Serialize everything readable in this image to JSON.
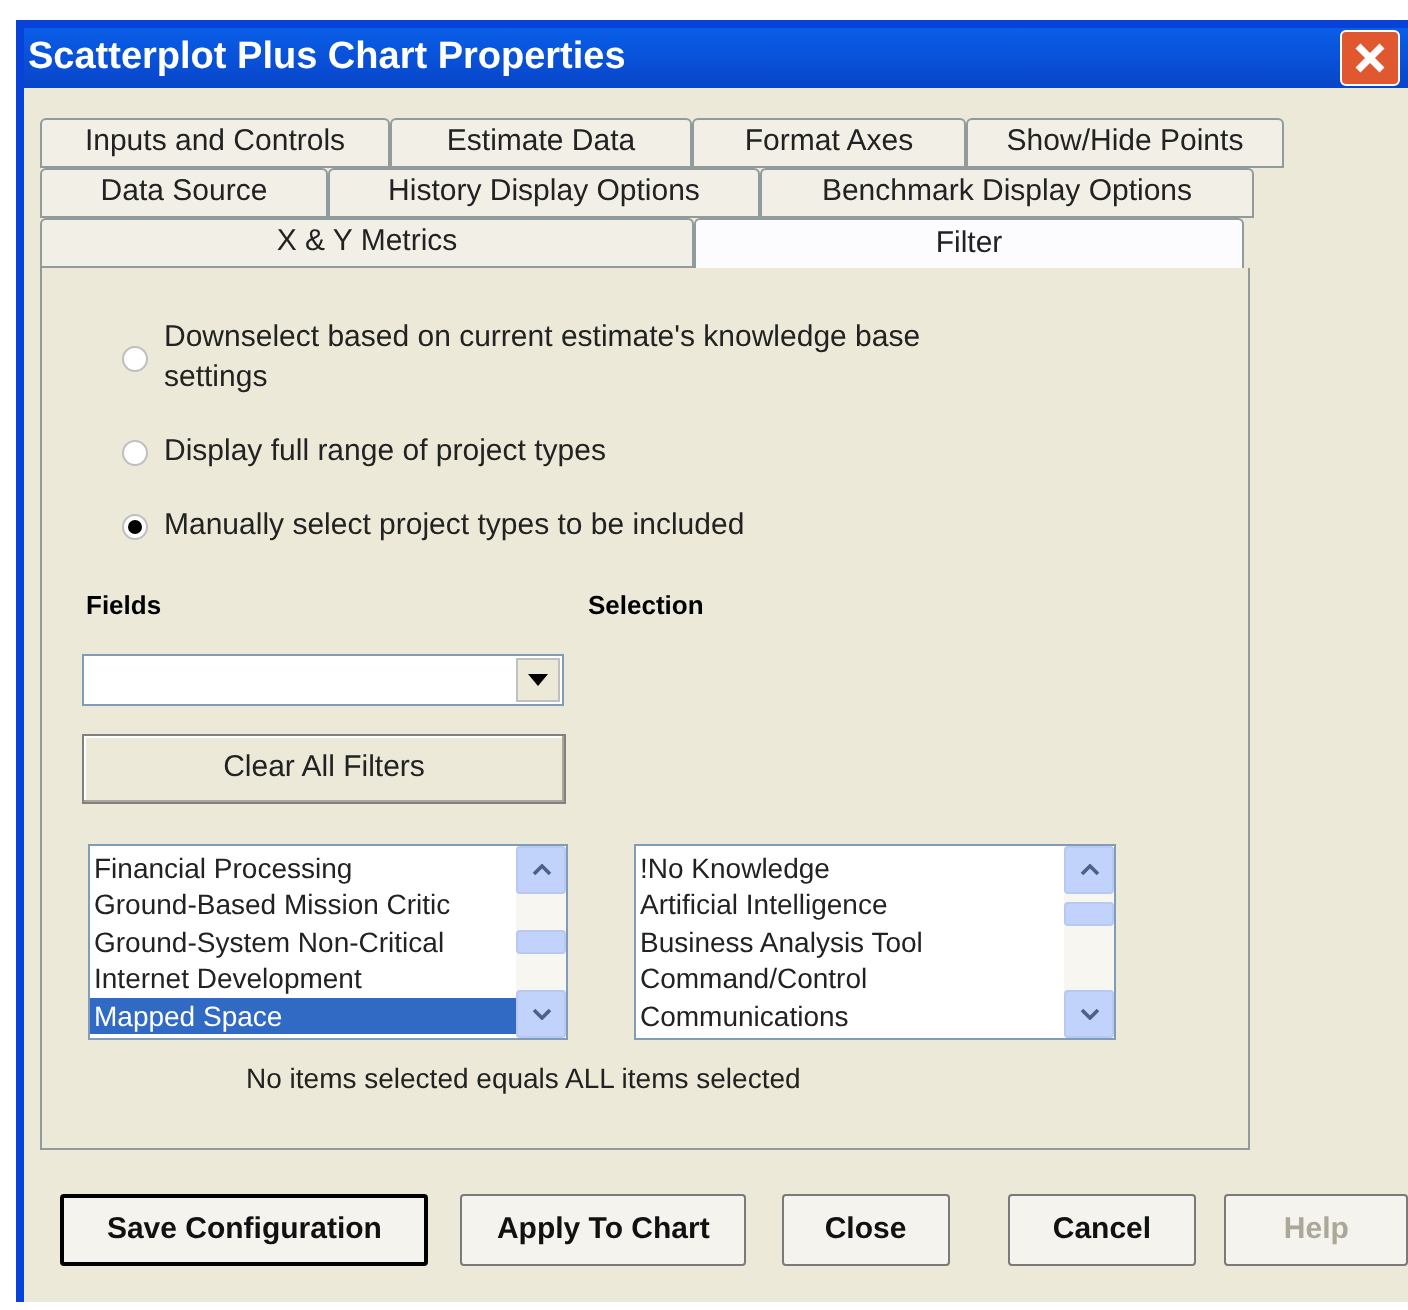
{
  "window": {
    "title": "Scatterplot Plus Chart Properties"
  },
  "tab_rows": [
    {
      "tabs": [
        {
          "label": "Inputs and Controls",
          "selected": false
        },
        {
          "label": "Estimate Data",
          "selected": false
        },
        {
          "label": "Format Axes",
          "selected": false
        },
        {
          "label": "Show/Hide Points",
          "selected": false
        }
      ]
    },
    {
      "tabs": [
        {
          "label": "Data Source",
          "selected": false
        },
        {
          "label": "History Display Options",
          "selected": false
        },
        {
          "label": "Benchmark Display Options",
          "selected": false
        }
      ]
    },
    {
      "tabs": [
        {
          "label": "X & Y Metrics",
          "selected": false
        },
        {
          "label": "Filter",
          "selected": true
        }
      ]
    }
  ],
  "radios": [
    {
      "label": "Downselect based on current estimate's knowledge base settings",
      "selected": false
    },
    {
      "label": "Display full range of project types",
      "selected": false
    },
    {
      "label": "Manually select project types to be included",
      "selected": true
    }
  ],
  "fields_label": "Fields",
  "selection_label": "Selection",
  "clear_button": "Clear All Filters",
  "fields_list": [
    {
      "label": "Financial Processing",
      "selected": false
    },
    {
      "label": "Ground-Based Mission Critic",
      "selected": false
    },
    {
      "label": "Ground-System Non-Critical",
      "selected": false
    },
    {
      "label": "Internet Development",
      "selected": false
    },
    {
      "label": "Mapped Space",
      "selected": true
    }
  ],
  "selection_list": [
    {
      "label": "!No Knowledge",
      "selected": false
    },
    {
      "label": "Artificial Intelligence",
      "selected": false
    },
    {
      "label": "Business Analysis Tool",
      "selected": false
    },
    {
      "label": "Command/Control",
      "selected": false
    },
    {
      "label": "Communications",
      "selected": false
    }
  ],
  "note": "No items selected equals ALL items selected",
  "buttons": [
    {
      "label": "Save Configuration",
      "default": true,
      "disabled": false
    },
    {
      "label": "Apply To Chart",
      "default": false,
      "disabled": false
    },
    {
      "label": "Close",
      "default": false,
      "disabled": false
    },
    {
      "label": "Cancel",
      "default": false,
      "disabled": false
    },
    {
      "label": "Help",
      "default": false,
      "disabled": true
    }
  ]
}
